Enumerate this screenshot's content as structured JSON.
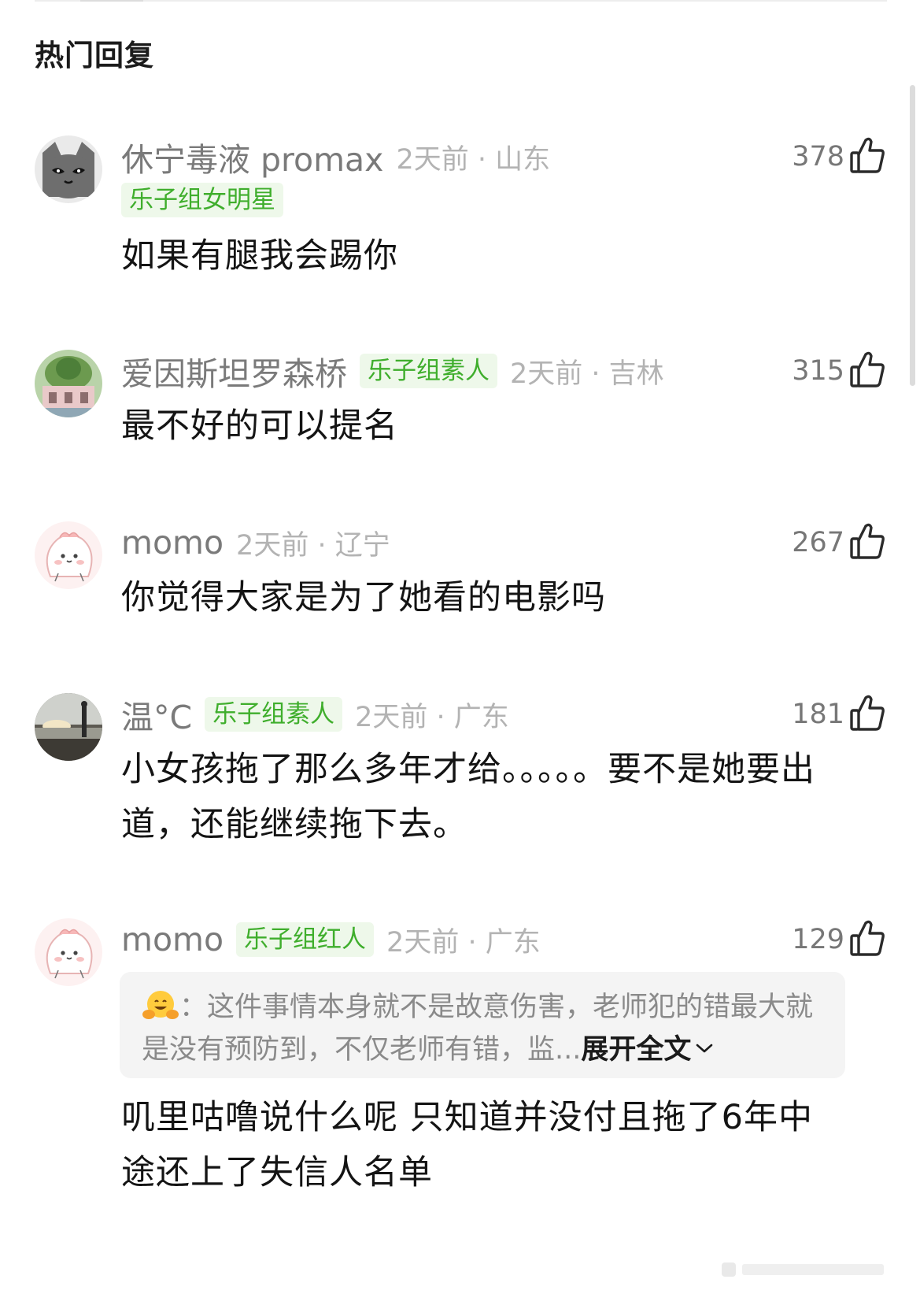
{
  "header": {
    "title": "热门回复"
  },
  "comments": [
    {
      "username": "休宁毒液 promax",
      "badge": "乐子组女明星",
      "time": "2天前",
      "location": "山东",
      "meta": "2天前 · 山东",
      "likes": "378",
      "text": "如果有腿我会踢你",
      "avatar_icon": "gray-cat-avatar"
    },
    {
      "username": "爱因斯坦罗森桥",
      "badge": "乐子组素人",
      "time": "2天前",
      "location": "吉林",
      "meta": "2天前 · 吉林",
      "likes": "315",
      "text": "最不好的可以提名",
      "avatar_icon": "building-photo-avatar"
    },
    {
      "username": "momo",
      "time": "2天前",
      "location": "辽宁",
      "meta": "2天前 · 辽宁",
      "likes": "267",
      "text": "你觉得大家是为了她看的电影吗",
      "avatar_icon": "pink-bun-avatar"
    },
    {
      "username": "温°C",
      "badge": "乐子组素人",
      "time": "2天前",
      "location": "广东",
      "meta": "2天前 · 广东",
      "likes": "181",
      "text": "小女孩拖了那么多年才给。。。。。要不是她要出道，还能继续拖下去。",
      "avatar_icon": "sunset-photo-avatar"
    },
    {
      "username": "momo",
      "badge": "乐子组红人",
      "time": "2天前",
      "location": "广东",
      "meta": "2天前 · 广东",
      "likes": "129",
      "quote": {
        "emoji": "hugging-face-emoji",
        "text": "：这件事情本身就不是故意伤害，老师犯的错最大就是没有预防到，不仅老师有错，监...",
        "expand_label": "展开全文"
      },
      "text": "叽里咕噜说什么呢 只知道并没付且拖了6年中途还上了失信人名单",
      "avatar_icon": "pink-bun-avatar"
    }
  ],
  "colors": {
    "badge_bg": "#eef8ea",
    "badge_text": "#3fae2c",
    "meta_text": "#b3b3b3",
    "username": "#7a7a7a"
  }
}
